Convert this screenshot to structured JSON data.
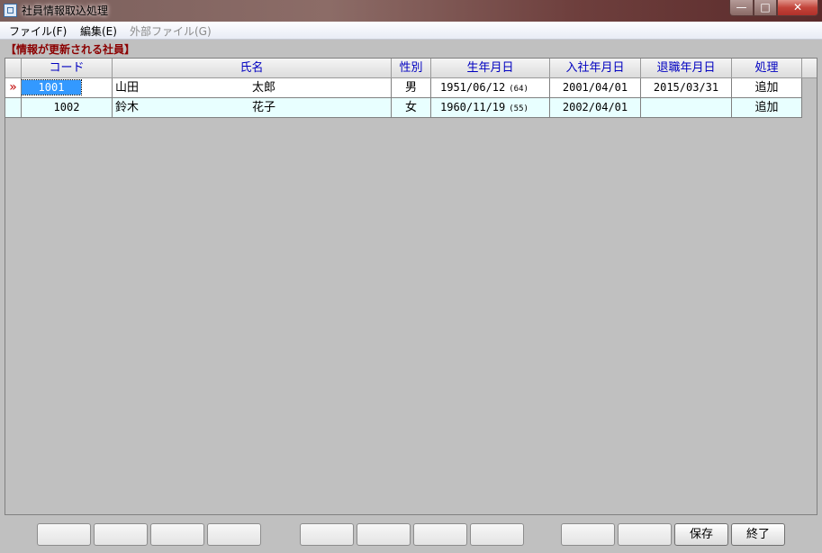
{
  "window": {
    "title": "社員情報取込処理",
    "min_label": "—",
    "max_label": "□",
    "close_label": "✕"
  },
  "menu": [
    {
      "label": "ファイル(F)",
      "enabled": true
    },
    {
      "label": "編集(E)",
      "enabled": true
    },
    {
      "label": "外部ファイル(G)",
      "enabled": false
    }
  ],
  "section_label": "【情報が更新される社員】",
  "table": {
    "columns": [
      "コード",
      "氏名",
      "性別",
      "生年月日",
      "入社年月日",
      "退職年月日",
      "処理"
    ],
    "row_indicator": "»",
    "rows": [
      {
        "code": "1001",
        "last_name": "山田",
        "first_name": "太郎",
        "gender": "男",
        "birth": "1951/06/12",
        "age": "(64)",
        "hire": "2001/04/01",
        "retire": "2015/03/31",
        "action": "追加"
      },
      {
        "code": "1002",
        "last_name": "鈴木",
        "first_name": "花子",
        "gender": "女",
        "birth": "1960/11/19",
        "age": "(55)",
        "hire": "2002/04/01",
        "retire": "",
        "action": "追加"
      }
    ]
  },
  "buttons": {
    "save": "保存",
    "exit": "終了"
  }
}
